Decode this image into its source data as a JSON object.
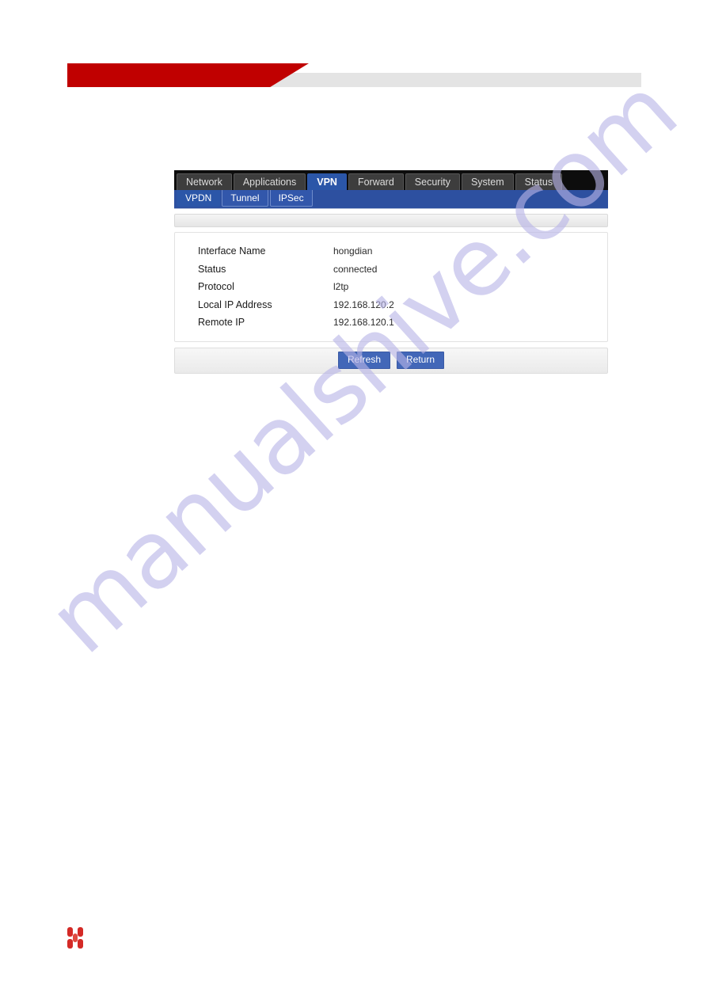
{
  "header": {
    "red_shape": "red-angled-banner",
    "gray_shape": "gray-banner-bar",
    "accent_red": "#C00000",
    "accent_gray": "#E4E4E4"
  },
  "router_ui": {
    "primary_nav": {
      "active": "VPN",
      "tabs": [
        {
          "label": "Network",
          "active": false
        },
        {
          "label": "Applications",
          "active": false
        },
        {
          "label": "VPN",
          "active": true
        },
        {
          "label": "Forward",
          "active": false
        },
        {
          "label": "Security",
          "active": false
        },
        {
          "label": "System",
          "active": false
        },
        {
          "label": "Status",
          "active": false
        }
      ]
    },
    "secondary_nav": {
      "active": "VPDN",
      "tabs": [
        {
          "label": "VPDN",
          "active": true
        },
        {
          "label": "Tunnel",
          "active": false
        },
        {
          "label": "IPSec",
          "active": false
        }
      ]
    },
    "panel_title": "",
    "info_rows": [
      {
        "label": "Interface Name",
        "value": "hongdian"
      },
      {
        "label": "Status",
        "value": "connected"
      },
      {
        "label": "Protocol",
        "value": "l2tp"
      },
      {
        "label": "Local IP Address",
        "value": "192.168.120.2"
      },
      {
        "label": "Remote IP",
        "value": "192.168.120.1"
      }
    ],
    "actions": {
      "refresh_label": "Refresh",
      "return_label": "Return",
      "button_color": "#4267B8"
    }
  },
  "watermark": {
    "text": "manualshive.com",
    "color": "#B9B5E8"
  },
  "footer": {
    "logo_name": "hongdian-logo",
    "logo_color": "#D42A26"
  }
}
